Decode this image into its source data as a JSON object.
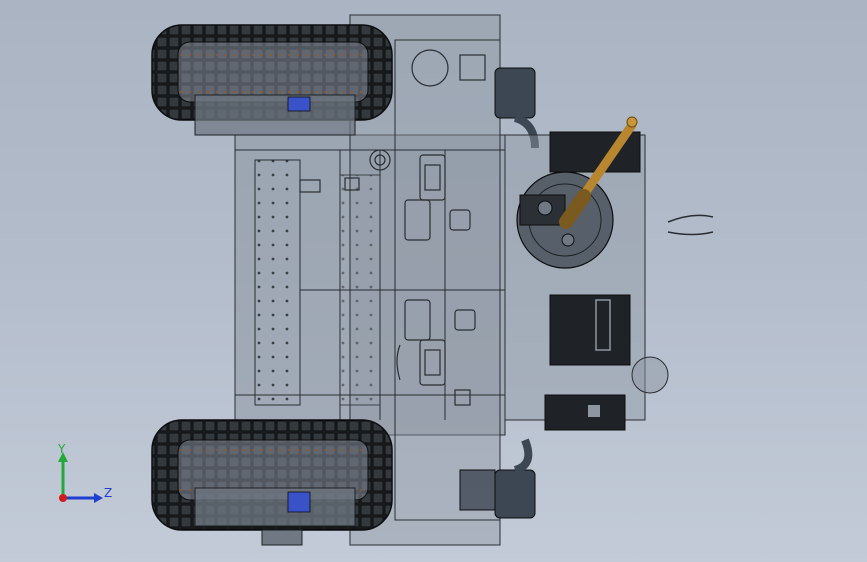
{
  "viewport": {
    "background_top": "#aab4c2",
    "background_bottom": "#c3cbd8"
  },
  "model": {
    "hull_fill": "#8d96a1",
    "edge_color": "#2a2d31",
    "track_color": "#1e2124",
    "link_color": "#8a5a2e",
    "barrel_color": "#b8862e",
    "motor_color": "#3d4653",
    "blue_part_color": "#3a52c8"
  },
  "triad": {
    "y_label": "Y",
    "z_label": "Z",
    "y_color": "#24a83a",
    "z_color": "#1f3fd1",
    "x_color": "#d11a1a",
    "icon": "coordinate-triad-icon"
  }
}
